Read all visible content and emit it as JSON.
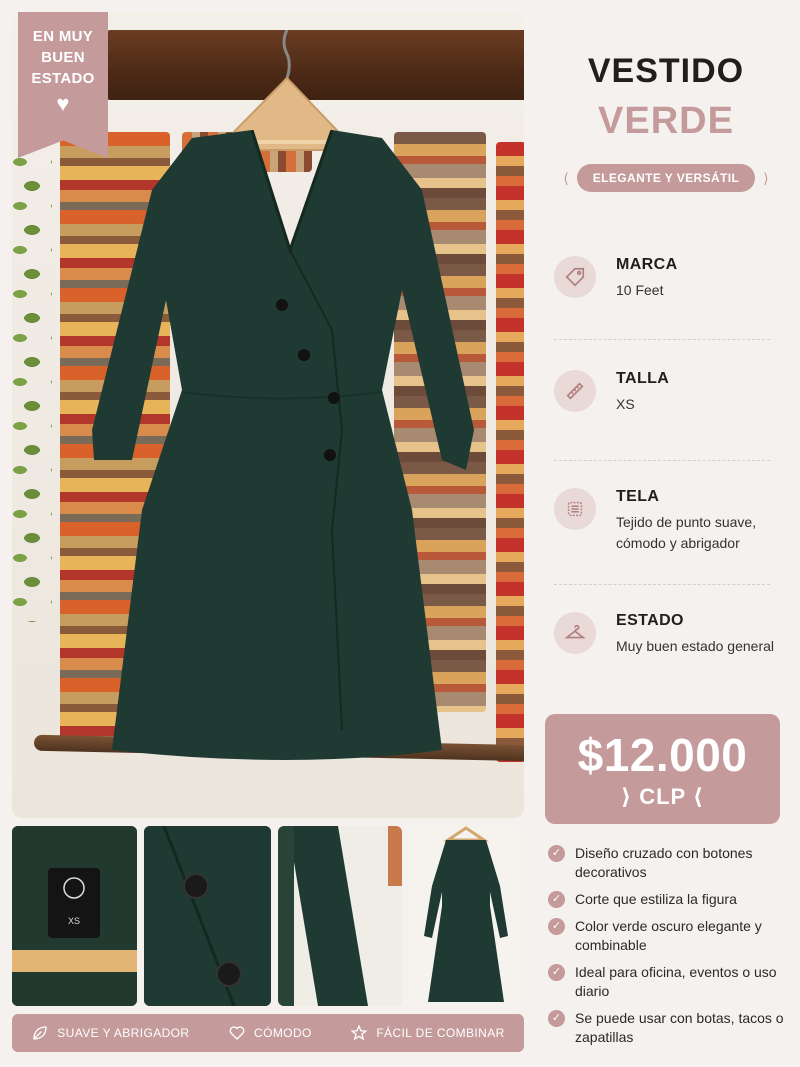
{
  "badge": {
    "line1": "EN MUY",
    "line2": "BUEN",
    "line3": "ESTADO",
    "icon": "heart-icon"
  },
  "title": {
    "line1": "VESTIDO",
    "line2": "VERDE"
  },
  "tagline": "ELEGANTE Y VERSÁTIL",
  "attributes": [
    {
      "label": "MARCA",
      "value": "10 Feet",
      "icon": "tag-icon"
    },
    {
      "label": "TALLA",
      "value": "XS",
      "icon": "ruler-icon"
    },
    {
      "label": "TELA",
      "value": "Tejido de punto suave, cómodo y abrigador",
      "icon": "fabric-icon"
    },
    {
      "label": "ESTADO",
      "value": "Muy buen estado general",
      "icon": "hanger-icon"
    }
  ],
  "price": {
    "amount": "$12.000",
    "currency": "CLP"
  },
  "features": [
    "Diseño cruzado con botones decorativos",
    "Corte que estiliza la figura",
    "Color verde oscuro elegante y combinable",
    "Ideal para oficina, eventos o uso diario",
    "Se puede usar con botas, tacos o zapatillas"
  ],
  "thumbnails": {
    "label_size": "XS"
  },
  "bottom_bar": [
    {
      "label": "SUAVE Y ABRIGADOR",
      "icon": "leaf-icon"
    },
    {
      "label": "CÓMODO",
      "icon": "heart-outline-icon"
    },
    {
      "label": "FÁCIL DE COMBINAR",
      "icon": "star-icon"
    }
  ],
  "colors": {
    "accent": "#c49a9a",
    "dress": "#1f3a33",
    "background": "#f4f1ee"
  }
}
